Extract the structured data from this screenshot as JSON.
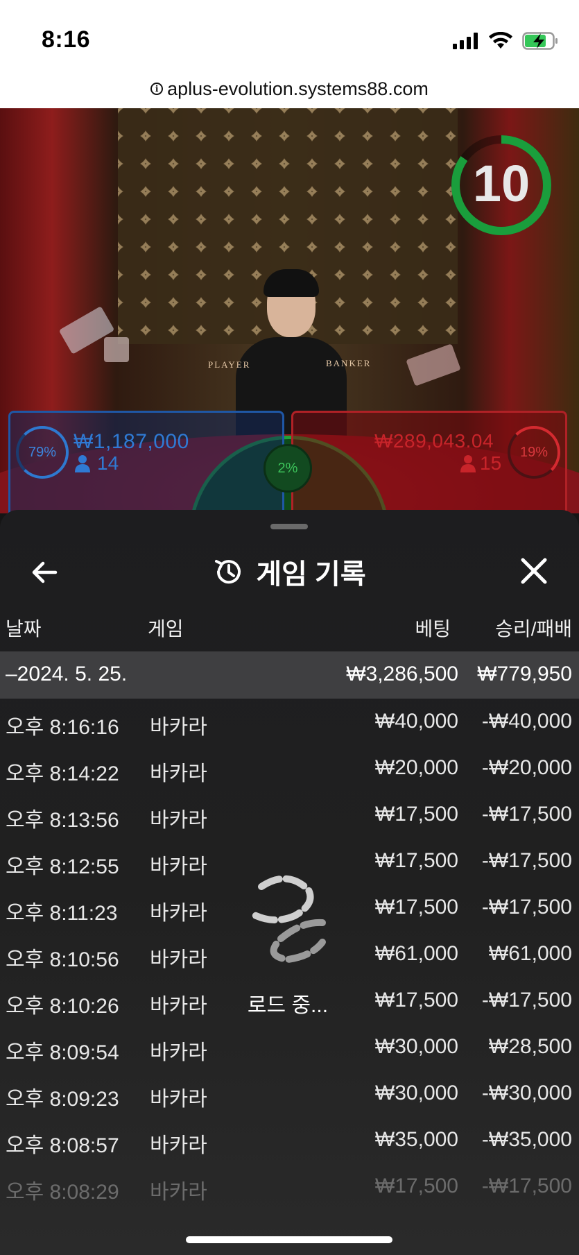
{
  "status_bar": {
    "time": "8:16"
  },
  "url_bar": {
    "url": "aplus-evolution.systems88.com"
  },
  "video": {
    "timer": "10",
    "table_labels": {
      "player": "PLAYER",
      "banker": "BANKER"
    },
    "player": {
      "pct": "79%",
      "amount": "₩1,187,000",
      "players": "14"
    },
    "banker": {
      "pct": "19%",
      "amount": "₩289,043.04",
      "players": "15"
    },
    "tie": {
      "pct": "2%"
    }
  },
  "panel": {
    "title": "게임 기록",
    "columns": {
      "date": "날짜",
      "game": "게임",
      "bet": "베팅",
      "win_loss": "승리/패배"
    },
    "date_group": {
      "date": "–2024. 5. 25.",
      "bet_total": "₩3,286,500",
      "win_total": "₩779,950"
    },
    "rows": [
      {
        "time": "오후 8:16:16",
        "game": "바카라",
        "bet": "₩40,000",
        "result": "-₩40,000"
      },
      {
        "time": "오후 8:14:22",
        "game": "바카라",
        "bet": "₩20,000",
        "result": "-₩20,000"
      },
      {
        "time": "오후 8:13:56",
        "game": "바카라",
        "bet": "₩17,500",
        "result": "-₩17,500"
      },
      {
        "time": "오후 8:12:55",
        "game": "바카라",
        "bet": "₩17,500",
        "result": "-₩17,500"
      },
      {
        "time": "오후 8:11:23",
        "game": "바카라",
        "bet": "₩17,500",
        "result": "-₩17,500"
      },
      {
        "time": "오후 8:10:56",
        "game": "바카라",
        "bet": "₩61,000",
        "result": "₩61,000"
      },
      {
        "time": "오후 8:10:26",
        "game": "바카라",
        "bet": "₩17,500",
        "result": "-₩17,500"
      },
      {
        "time": "오후 8:09:54",
        "game": "바카라",
        "bet": "₩30,000",
        "result": "₩28,500"
      },
      {
        "time": "오후 8:09:23",
        "game": "바카라",
        "bet": "₩30,000",
        "result": "-₩30,000"
      },
      {
        "time": "오후 8:08:57",
        "game": "바카라",
        "bet": "₩35,000",
        "result": "-₩35,000"
      },
      {
        "time": "오후 8:08:29",
        "game": "바카라",
        "bet": "₩17,500",
        "result": "-₩17,500"
      }
    ],
    "loading_text": "로드 중..."
  }
}
